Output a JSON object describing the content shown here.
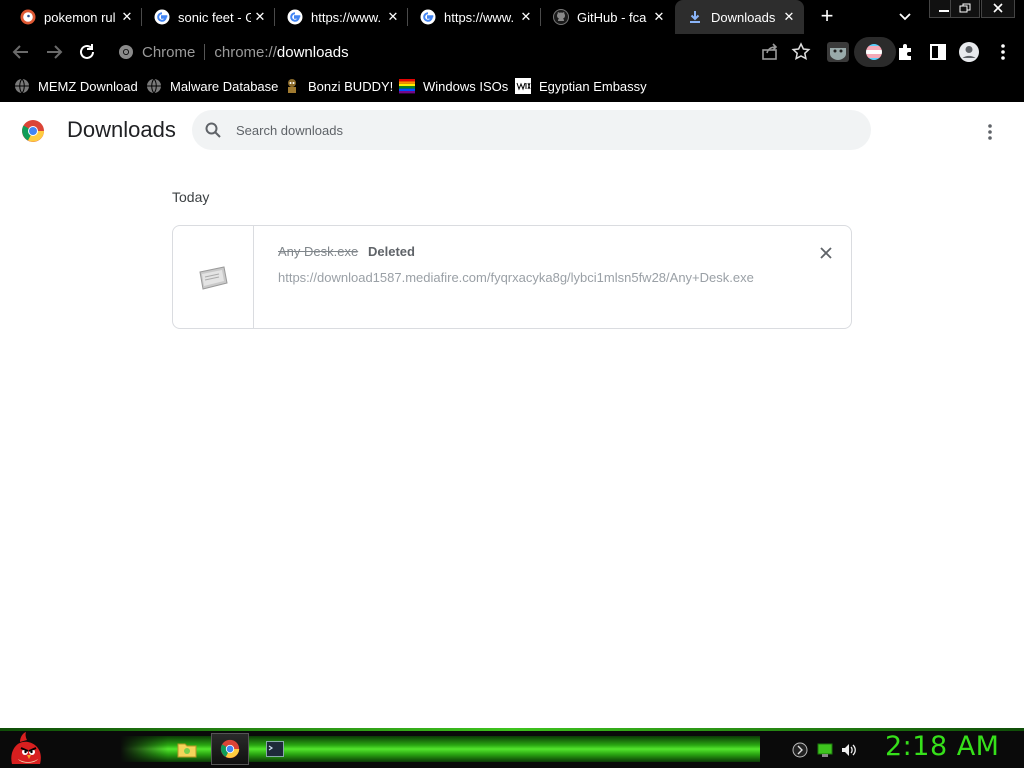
{
  "tabs": [
    {
      "title": "pokemon rul",
      "favicon": "duckduckgo-icon",
      "active": false
    },
    {
      "title": "sonic feet - G",
      "favicon": "google-icon",
      "active": false
    },
    {
      "title": "https://www.",
      "favicon": "google-icon",
      "active": false
    },
    {
      "title": "https://www.",
      "favicon": "google-icon",
      "active": false
    },
    {
      "title": "GitHub - fca",
      "favicon": "github-icon",
      "active": false
    },
    {
      "title": "Downloads",
      "favicon": "download-icon",
      "active": true
    }
  ],
  "toolbar": {
    "omnibox_origin": "Chrome",
    "omnibox_scheme": "chrome://",
    "omnibox_path": "downloads"
  },
  "bookmarks": [
    {
      "label": "MEMZ Download",
      "icon": "globe-icon"
    },
    {
      "label": "Malware Database",
      "icon": "globe-icon"
    },
    {
      "label": "Bonzi BUDDY!",
      "icon": "bonzi-icon"
    },
    {
      "label": "Windows ISOs",
      "icon": "rainbow-flag-icon"
    },
    {
      "label": "Egyptian Embassy",
      "icon": "wix-icon"
    }
  ],
  "downloads": {
    "title": "Downloads",
    "search_placeholder": "Search downloads",
    "section": "Today",
    "items": [
      {
        "file_name": "Any Desk.exe",
        "status": "Deleted",
        "url": "https://download1587.mediafire.com/fyqrxacyka8g/lybci1mlsn5fw28/Any+Desk.exe"
      }
    ]
  },
  "taskbar": {
    "clock": "2:18 AM",
    "accent_color": "#36e01a"
  },
  "colors": {
    "chrome_dark": "#000000",
    "page_bg": "#ffffff",
    "search_bg": "#f1f3f4"
  }
}
